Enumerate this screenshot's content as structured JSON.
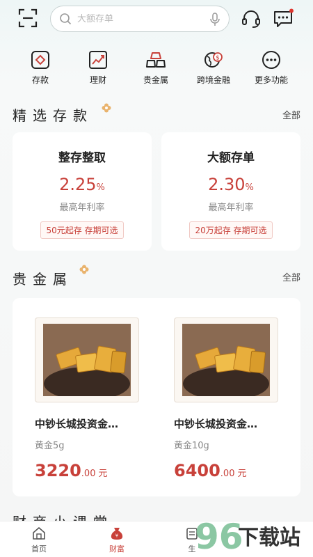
{
  "search": {
    "placeholder": "大额存单"
  },
  "quick_menu": [
    {
      "label": "存款",
      "icon": "deposit-icon"
    },
    {
      "label": "理财",
      "icon": "chart-icon"
    },
    {
      "label": "贵金属",
      "icon": "gold-bars-icon"
    },
    {
      "label": "跨境金融",
      "icon": "globe-dollar-icon"
    },
    {
      "label": "更多功能",
      "icon": "more-icon"
    }
  ],
  "deposits": {
    "title": "精选存款",
    "all_label": "全部",
    "items": [
      {
        "name": "整存整取",
        "rate": "2.25",
        "rate_unit": "%",
        "rate_label": "最高年利率",
        "tag": "50元起存 存期可选"
      },
      {
        "name": "大额存单",
        "rate": "2.30",
        "rate_unit": "%",
        "rate_label": "最高年利率",
        "tag": "20万起存 存期可选"
      }
    ]
  },
  "metals": {
    "title": "贵金属",
    "all_label": "全部",
    "items": [
      {
        "name": "中钞长城投资金…",
        "spec": "黄金5g",
        "price_int": "3220",
        "price_dec": ".00",
        "unit": "元"
      },
      {
        "name": "中钞长城投资金…",
        "spec": "黄金10g",
        "price_int": "6400",
        "price_dec": ".00",
        "unit": "元"
      }
    ]
  },
  "next_section": {
    "title": "财商小课堂"
  },
  "tabbar": [
    {
      "label": "首页",
      "icon": "home-icon",
      "active": false
    },
    {
      "label": "财富",
      "icon": "wealth-bag-icon",
      "active": true
    },
    {
      "label": "生",
      "icon": "life-icon",
      "active": false
    }
  ],
  "watermark": {
    "text": "96下载站"
  },
  "colors": {
    "accent": "#c8413a",
    "gold": "#e6a93a",
    "bg": "#f5f6f6"
  }
}
